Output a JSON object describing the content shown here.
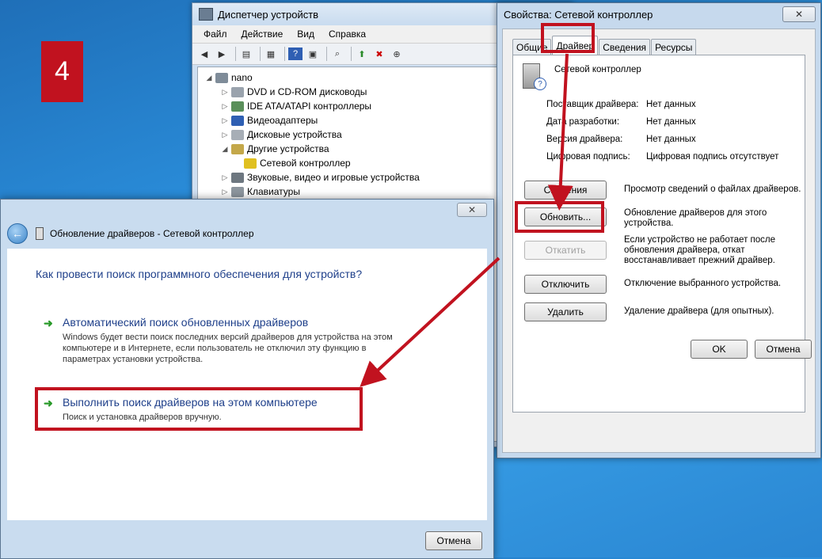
{
  "badge": "4",
  "device_manager": {
    "title": "Диспетчер устройств",
    "menu": [
      "Файл",
      "Действие",
      "Вид",
      "Справка"
    ],
    "tree": [
      {
        "label": "nano",
        "level": 0,
        "arrow": "◢"
      },
      {
        "label": "DVD и CD-ROM дисководы",
        "level": 1,
        "arrow": "▷"
      },
      {
        "label": "IDE ATA/ATAPI контроллеры",
        "level": 1,
        "arrow": "▷"
      },
      {
        "label": "Видеоадаптеры",
        "level": 1,
        "arrow": "▷"
      },
      {
        "label": "Дисковые устройства",
        "level": 1,
        "arrow": "▷"
      },
      {
        "label": "Другие устройства",
        "level": 1,
        "arrow": "◢"
      },
      {
        "label": "Сетевой контроллер",
        "level": 2,
        "arrow": ""
      },
      {
        "label": "Звуковые, видео и игровые устройства",
        "level": 1,
        "arrow": "▷"
      },
      {
        "label": "Клавиатуры",
        "level": 1,
        "arrow": "▷"
      }
    ]
  },
  "properties": {
    "title": "Свойства: Сетевой контроллер",
    "close": "✕",
    "tabs": [
      "Общие",
      "Драйвер",
      "Сведения",
      "Ресурсы"
    ],
    "device_name": "Сетевой контроллер",
    "fields": [
      {
        "label": "Поставщик драйвера:",
        "value": "Нет данных"
      },
      {
        "label": "Дата разработки:",
        "value": "Нет данных"
      },
      {
        "label": "Версия драйвера:",
        "value": "Нет данных"
      },
      {
        "label": "Цифровая подпись:",
        "value": "Цифровая подпись отсутствует"
      }
    ],
    "actions": [
      {
        "button": "Сведения",
        "desc": "Просмотр сведений о файлах драйверов.",
        "enabled": true
      },
      {
        "button": "Обновить...",
        "desc": "Обновление драйверов для этого устройства.",
        "enabled": true
      },
      {
        "button": "Откатить",
        "desc": "Если устройство не работает после обновления драйвера, откат восстанавливает прежний драйвер.",
        "enabled": false
      },
      {
        "button": "Отключить",
        "desc": "Отключение выбранного устройства.",
        "enabled": true
      },
      {
        "button": "Удалить",
        "desc": "Удаление драйвера (для опытных).",
        "enabled": true
      }
    ],
    "ok": "OK",
    "cancel": "Отмена"
  },
  "wizard": {
    "close": "✕",
    "title": "Обновление драйверов - Сетевой контроллер",
    "question": "Как провести поиск программного обеспечения для устройств?",
    "option1_title": "Автоматический поиск обновленных драйверов",
    "option1_desc": "Windows будет вести поиск последних версий драйверов для устройства на этом компьютере и в Интернете, если пользователь не отключил эту функцию в параметрах установки устройства.",
    "option2_title": "Выполнить поиск драйверов на этом компьютере",
    "option2_desc": "Поиск и установка драйверов вручную.",
    "cancel": "Отмена"
  },
  "colors": {
    "highlight": "#c1121f",
    "link": "#1e3f8a",
    "arrow_green": "#2a9a2a"
  }
}
